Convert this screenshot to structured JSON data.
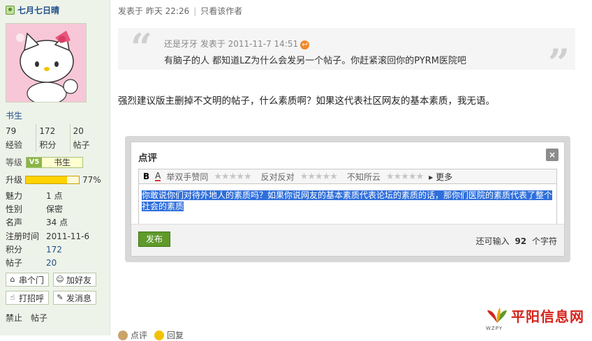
{
  "user": {
    "name": "七月七日晴",
    "title": "书生",
    "stats": [
      {
        "value": "79",
        "label": "经验"
      },
      {
        "value": "172",
        "label": "积分"
      },
      {
        "value": "20",
        "label": "帖子"
      }
    ],
    "level_label": "等级",
    "level_badge": "V5",
    "level_name": "书生",
    "upgrade_label": "升级",
    "upgrade_percent": "77%",
    "upgrade_fraction": 0.77,
    "info": [
      {
        "key": "魅力",
        "value": "1 点",
        "blue": false
      },
      {
        "key": "性别",
        "value": "保密",
        "blue": false
      },
      {
        "key": "名声",
        "value": "34 点",
        "blue": false
      },
      {
        "key": "注册时间",
        "value": "2011-11-6",
        "blue": false
      },
      {
        "key": "积分",
        "value": "172",
        "blue": true
      },
      {
        "key": "帖子",
        "value": "20",
        "blue": true
      }
    ],
    "actions": [
      "串个门",
      "加好友",
      "打招呼",
      "发消息"
    ],
    "ban_label": "禁止",
    "ban_target": "帖子"
  },
  "post": {
    "meta_time": "发表于 昨天 22:26",
    "meta_only_author": "只看该作者",
    "quote_meta": "还是牙牙 发表于 2011-11-7 14:51",
    "quote_text": "有脑子的人 都知道LZ为什么会发另一个帖子。你赶紧滚回你的PYRM医院吧",
    "body": "强烈建议版主删掉不文明的帖子，什么素质啊？如果这代表社区网友的基本素质，我无语。"
  },
  "dialog": {
    "title": "点评",
    "close_glyph": "×",
    "toolbar": {
      "bold": "B",
      "color": "A",
      "rating1": "举双手赞同",
      "rating2": "反对反对",
      "rating3": "不知所云",
      "more": "更多",
      "stars": "★★★★★"
    },
    "textarea_text": "你敢说你们对待外地人的素质吗？如果你说网友的基本素质代表论坛的素质的话，那你们医院的素质代表了整个社会的素质",
    "publish_label": "发布",
    "remain_prefix": "还可输入",
    "remain_count": "92",
    "remain_suffix": "个字符"
  },
  "footer": {
    "links": [
      "点评",
      "回复"
    ]
  },
  "watermark": {
    "text": "平阳信息网",
    "sub": "WZPY"
  },
  "colors": {
    "sidebar_bg": "#eef3e9",
    "accent_green": "#5f9a2b",
    "link_blue": "#1e4f8b",
    "selection": "#2f6fdb",
    "logo_red": "#d5231b"
  }
}
